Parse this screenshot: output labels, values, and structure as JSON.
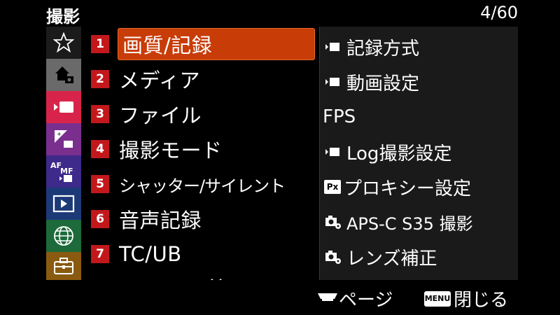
{
  "header": {
    "title": "撮影",
    "page_counter": "4/60"
  },
  "sidebar": {
    "items": [
      {
        "icon": "star-icon",
        "color": "#1b1b1b"
      },
      {
        "icon": "camera-home-icon",
        "color": "#6a6a6a"
      },
      {
        "icon": "movie-icon",
        "color": "#d8244a"
      },
      {
        "icon": "exposure-color-icon",
        "color": "#7a2f8e"
      },
      {
        "icon": "af-mf-icon",
        "color": "#3d2a8a"
      },
      {
        "icon": "playback-icon",
        "color": "#1d3a78"
      },
      {
        "icon": "network-icon",
        "color": "#1d6a3a"
      },
      {
        "icon": "toolbox-icon",
        "color": "#8a5a10"
      }
    ]
  },
  "menu": {
    "items": [
      {
        "num": "1",
        "label": "画質/記録",
        "selected": true
      },
      {
        "num": "2",
        "label": "メディア"
      },
      {
        "num": "3",
        "label": "ファイル"
      },
      {
        "num": "4",
        "label": "撮影モード"
      },
      {
        "num": "5",
        "label": "シャッター/サイレント"
      },
      {
        "num": "6",
        "label": "音声記録"
      },
      {
        "num": "7",
        "label": "TC/UB"
      }
    ]
  },
  "submenu": {
    "items": [
      {
        "icon": "movie-small-icon",
        "label": "記録方式"
      },
      {
        "icon": "movie-small-icon",
        "label": "動画設定"
      },
      {
        "icon": "",
        "label": "FPS"
      },
      {
        "icon": "movie-small-icon",
        "label": "Log撮影設定"
      },
      {
        "icon": "px-proxy-icon",
        "icon_text": "Px",
        "label": "プロキシー設定"
      },
      {
        "icon": "camera-settings-icon",
        "label": "APS-C S35 撮影"
      },
      {
        "icon": "camera-settings-icon",
        "label": "レンズ補正"
      }
    ]
  },
  "footer": {
    "page_hint": "ページ",
    "menu_key": "MENU",
    "close_label": "閉じる"
  },
  "colors": {
    "accent": "#c83c08",
    "number_badge": "#c2181c",
    "submenu_bg": "#1a1a1a"
  }
}
